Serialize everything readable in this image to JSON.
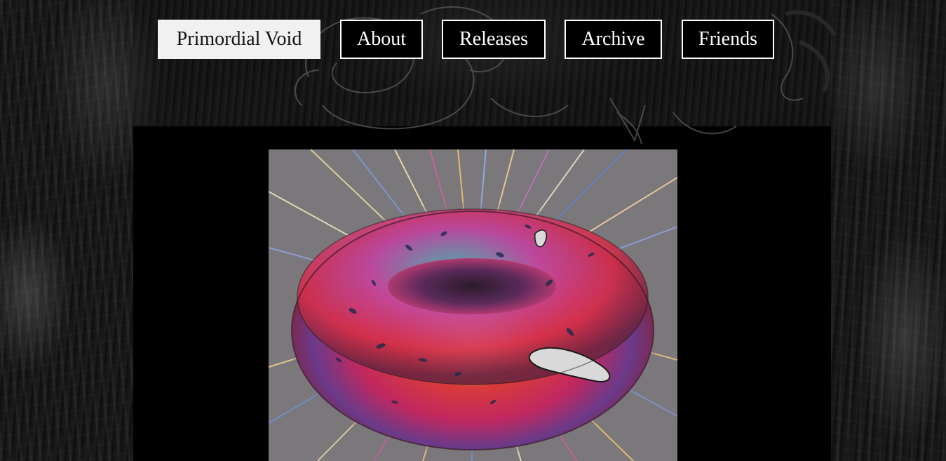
{
  "site": {
    "title": "Primordial Void"
  },
  "nav": {
    "items": [
      {
        "label": "About"
      },
      {
        "label": "Releases"
      },
      {
        "label": "Archive"
      },
      {
        "label": "Friends"
      }
    ]
  },
  "main": {
    "artwork": {
      "subject": "psychedelic-torus-image"
    }
  },
  "colors": {
    "background": "#0a0a0a",
    "column": "#000000",
    "nav_text": "#ffffff",
    "nav_border": "#ffffff",
    "home_bg": "#f1f1f1",
    "home_text": "#111111",
    "artwork_gray": "#7a787a"
  }
}
